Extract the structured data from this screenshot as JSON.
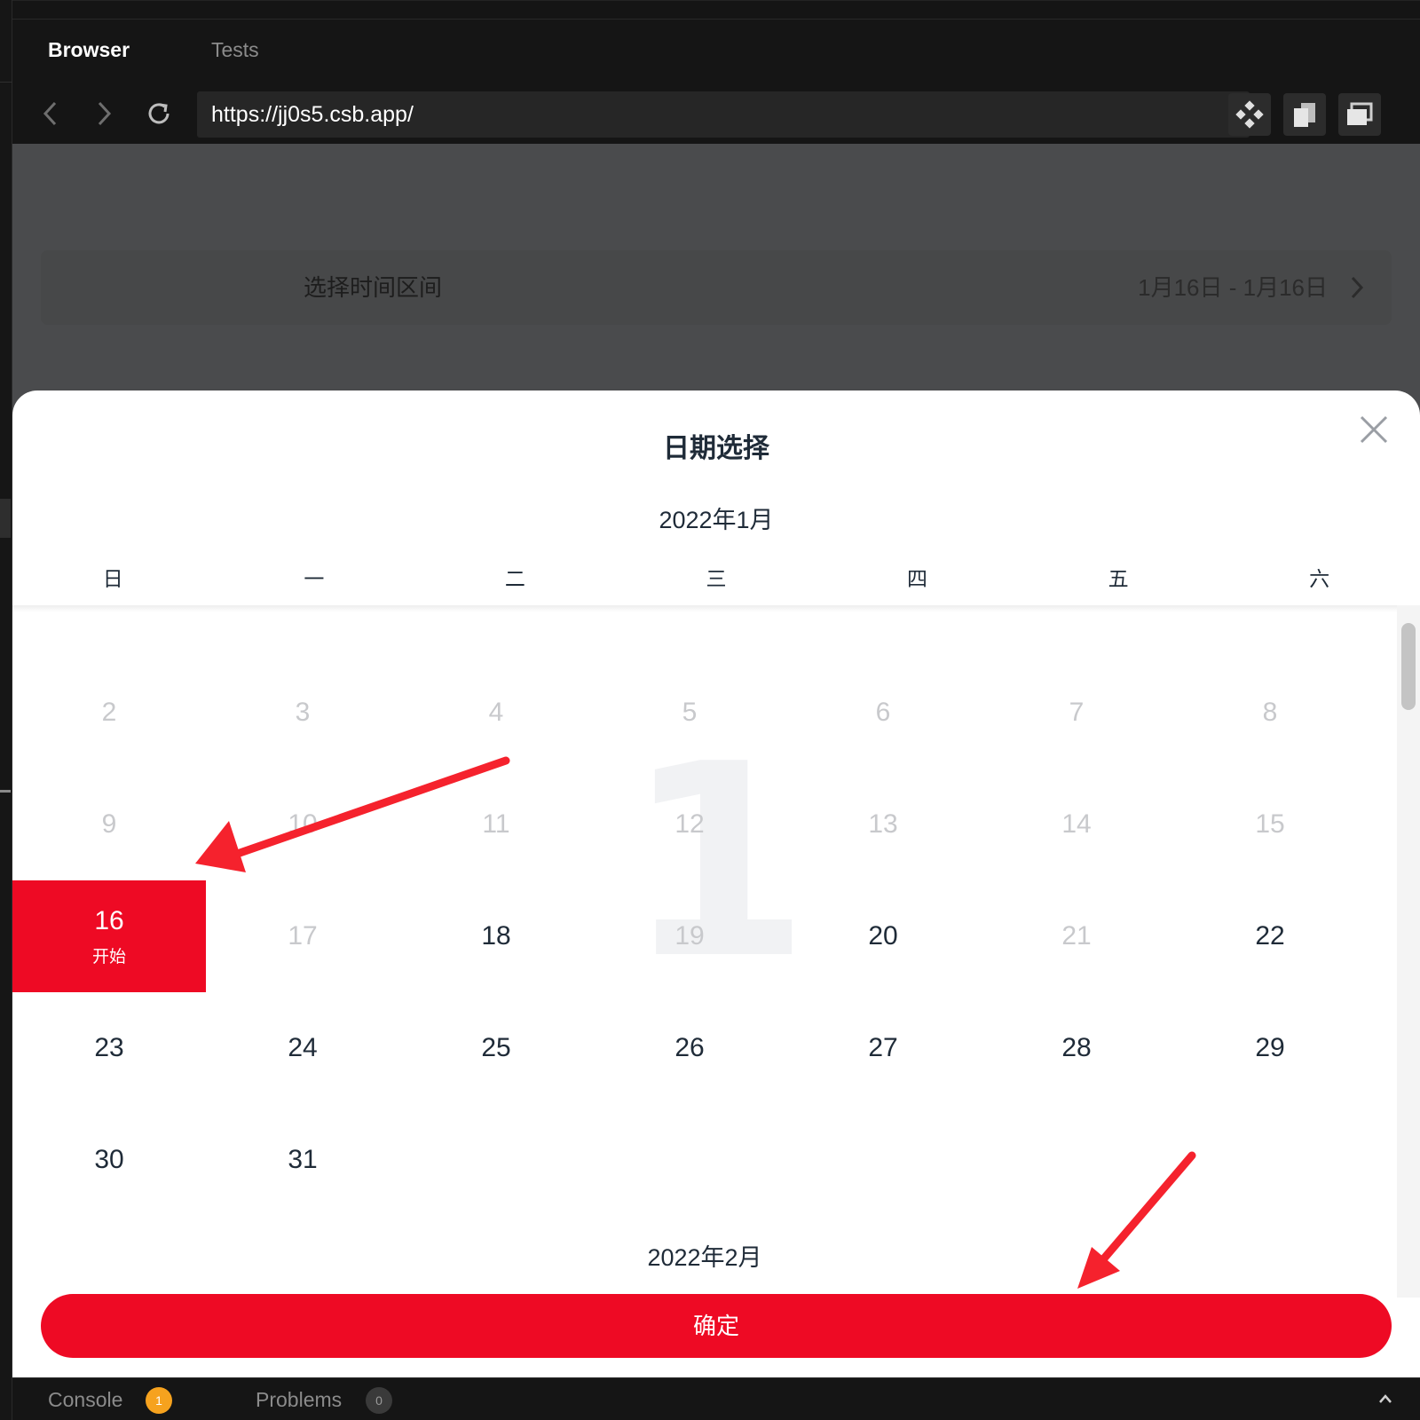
{
  "tabs": {
    "browser": "Browser",
    "tests": "Tests"
  },
  "nav": {
    "back_icon": "chevron-left-icon",
    "forward_icon": "chevron-right-icon",
    "reload_icon": "reload-icon"
  },
  "address_bar": {
    "url": "https://jj0s5.csb.app/"
  },
  "tools": [
    "diamond-grid-icon",
    "copy-window-icon",
    "new-window-icon"
  ],
  "field": {
    "label": "选择时间区间",
    "value": "1月16日 - 1月16日"
  },
  "calendar": {
    "title": "日期选择",
    "month": "2022年1月",
    "next_month": "2022年2月",
    "watermark": "1",
    "weekdays": [
      "日",
      "一",
      "二",
      "三",
      "四",
      "五",
      "六"
    ],
    "days": {
      "d2": "2",
      "d3": "3",
      "d4": "4",
      "d5": "5",
      "d6": "6",
      "d7": "7",
      "d8": "8",
      "d9": "9",
      "d10": "10",
      "d11": "11",
      "d12": "12",
      "d13": "13",
      "d14": "14",
      "d15": "15",
      "d16": "16",
      "d17": "17",
      "d18": "18",
      "d19": "19",
      "d20": "20",
      "d21": "21",
      "d22": "22",
      "d23": "23",
      "d24": "24",
      "d25": "25",
      "d26": "26",
      "d27": "27",
      "d28": "28",
      "d29": "29",
      "d30": "30",
      "d31": "31"
    },
    "start_label": "开始",
    "confirm_label": "确定"
  },
  "bottom": {
    "console": "Console",
    "console_badge": "1",
    "problems": "Problems",
    "problems_badge": "0"
  },
  "colors": {
    "accent": "#ee0a24",
    "annotation_arrow": "#f5222d"
  }
}
